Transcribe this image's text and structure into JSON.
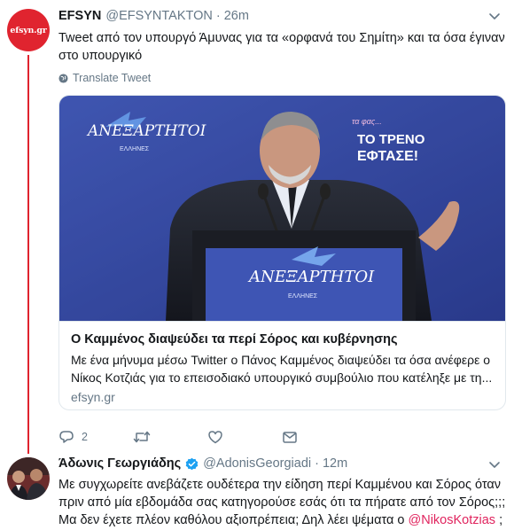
{
  "tweet1": {
    "avatar_text": "efsyn.gr",
    "name": "EFSYN",
    "handle": "@EFSYNTAKTON",
    "separator": "·",
    "time": "26m",
    "text": "Tweet από τον υπουργό Άμυνας για τα «ορφανά του Σημίτη» και τα όσα έγιναν στο υπουργικό",
    "translate_label": "Translate Tweet",
    "card": {
      "image_texts": {
        "logo_left": "ΑΝΕΞΑΡΤΗΤΟΙ",
        "logo_left_sub": "ΕΛΛΗΝΕΣ",
        "slogan_small": "τα φας...",
        "slogan_line1": "ΤΟ ΤΡΕΝΟ",
        "slogan_line2": "ΕΦΤΑΣΕ!",
        "podium_logo": "ΑΝΕΞΑΡΤΗΤΟΙ",
        "podium_sub": "ΕΛΛΗΝΕΣ"
      },
      "title": "Ο Καμμένος διαψεύδει τα περί Σόρος και κυβέρνησης",
      "description": "Με ένα μήνυμα μέσω Twitter ο Πάνος Καμμένος διαψεύδει τα όσα ανέφερε ο Νίκος Κοτζιάς για το επεισοδιακό υπουργικό συμβούλιο που κατέληξε με τη...",
      "domain": "efsyn.gr"
    },
    "actions": {
      "reply_count": "2",
      "retweet_count": "",
      "like_count": ""
    }
  },
  "tweet2": {
    "name": "Άδωνις Γεωργιάδης",
    "handle": "@AdonisGeorgiadi",
    "separator": "·",
    "time": "12m",
    "text_main": "Με συγχωρείτε ανεβάζετε ουδέτερα την είδηση περί Καμμένου και Σόρος όταν πριν από μία εβδομάδα σας κατηγορούσε εσάς ότι τα πήρατε από τον Σόρος;;; Μα δεν έχετε πλέον καθόλου αξιοπρέπεια; Δηλ λέει ψέματα ο ",
    "mention": "@NikosKotzias",
    "text_end": " ;"
  },
  "colors": {
    "accent": "#e0242f",
    "secondary_text": "#657786",
    "mention": "#e0245e",
    "verified": "#1da1f2"
  }
}
